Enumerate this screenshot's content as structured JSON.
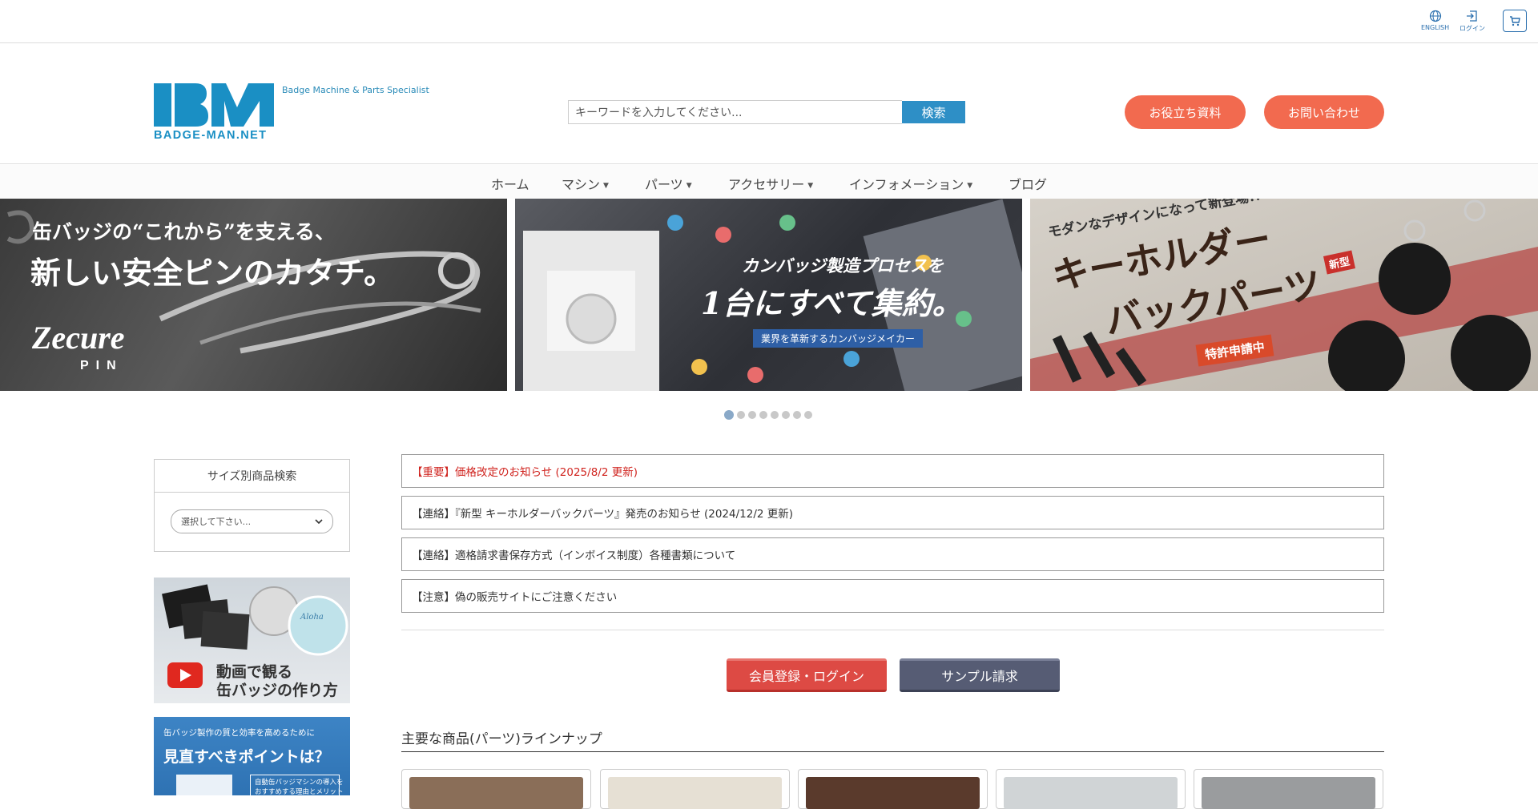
{
  "util": {
    "english_label": "ENGLISH",
    "login_label": "ログイン"
  },
  "header": {
    "logo_brand": "BADGE-MAN.NET",
    "tagline": "Badge Machine & Parts Specialist",
    "search_placeholder": "キーワードを入力してください...",
    "search_button": "検索",
    "resources_button": "お役立ち資料",
    "contact_button": "お問い合わせ"
  },
  "nav": {
    "items": [
      {
        "label": "ホーム",
        "dropdown": false
      },
      {
        "label": "マシン",
        "dropdown": true
      },
      {
        "label": "パーツ",
        "dropdown": true
      },
      {
        "label": "アクセサリー",
        "dropdown": true
      },
      {
        "label": "インフォメーション",
        "dropdown": true
      },
      {
        "label": "ブログ",
        "dropdown": false
      }
    ]
  },
  "banners": [
    {
      "line1": "缶バッジの“これから”を支える、",
      "line2": "新しい安全ピンのカタチ。",
      "brand": "Zecure",
      "brand_sub": "PIN"
    },
    {
      "line1": "カンバッジ製造プロセスを",
      "line2": "1台にすべて集約。",
      "caption": "業界を革新するカンバッジメイカー"
    },
    {
      "line1": "モダンなデザインになって新登場!!",
      "line2": "キーホルダー",
      "line3": "バックパーツ",
      "badge_new": "新型",
      "badge_patent": "特許申請中"
    }
  ],
  "slider": {
    "count": 8,
    "active_index": 0
  },
  "sidebar": {
    "size_search_title": "サイズ別商品検索",
    "size_select_value": "選択して下さい...",
    "video_banner_line1": "動画で観る",
    "video_banner_line2": "缶バッジの作り方",
    "video_banner_tag": "Aloha",
    "points_banner_line1": "缶バッジ製作の質と効率を高めるために",
    "points_banner_line2": "見直すべきポイントは？",
    "points_banner_box1": "自動缶バッジマシンの導入を",
    "points_banner_box2": "おすすめする理由とメリット"
  },
  "notices": [
    {
      "text": "【重要】価格改定のお知らせ (2025/8/2 更新)",
      "important": true
    },
    {
      "text": "【連絡】『新型 キーホルダーバックパーツ』発売のお知らせ (2024/12/2 更新)",
      "important": false
    },
    {
      "text": "【連絡】適格請求書保存方式（インボイス制度）各種書類について",
      "important": false
    },
    {
      "text": "【注意】偽の販売サイトにご注意ください",
      "important": false
    }
  ],
  "cta": {
    "member_button": "会員登録・ログイン",
    "sample_button": "サンプル請求"
  },
  "products_section": {
    "title": "主要な商品(パーツ)ラインナップ"
  },
  "colors": {
    "accent_blue": "#2e8fc6",
    "logo_blue": "#1a8fc4",
    "pill_orange": "#f26a4f",
    "cta_red": "#dd4a44",
    "cta_slate": "#565c74",
    "important_red": "#d0241f"
  }
}
